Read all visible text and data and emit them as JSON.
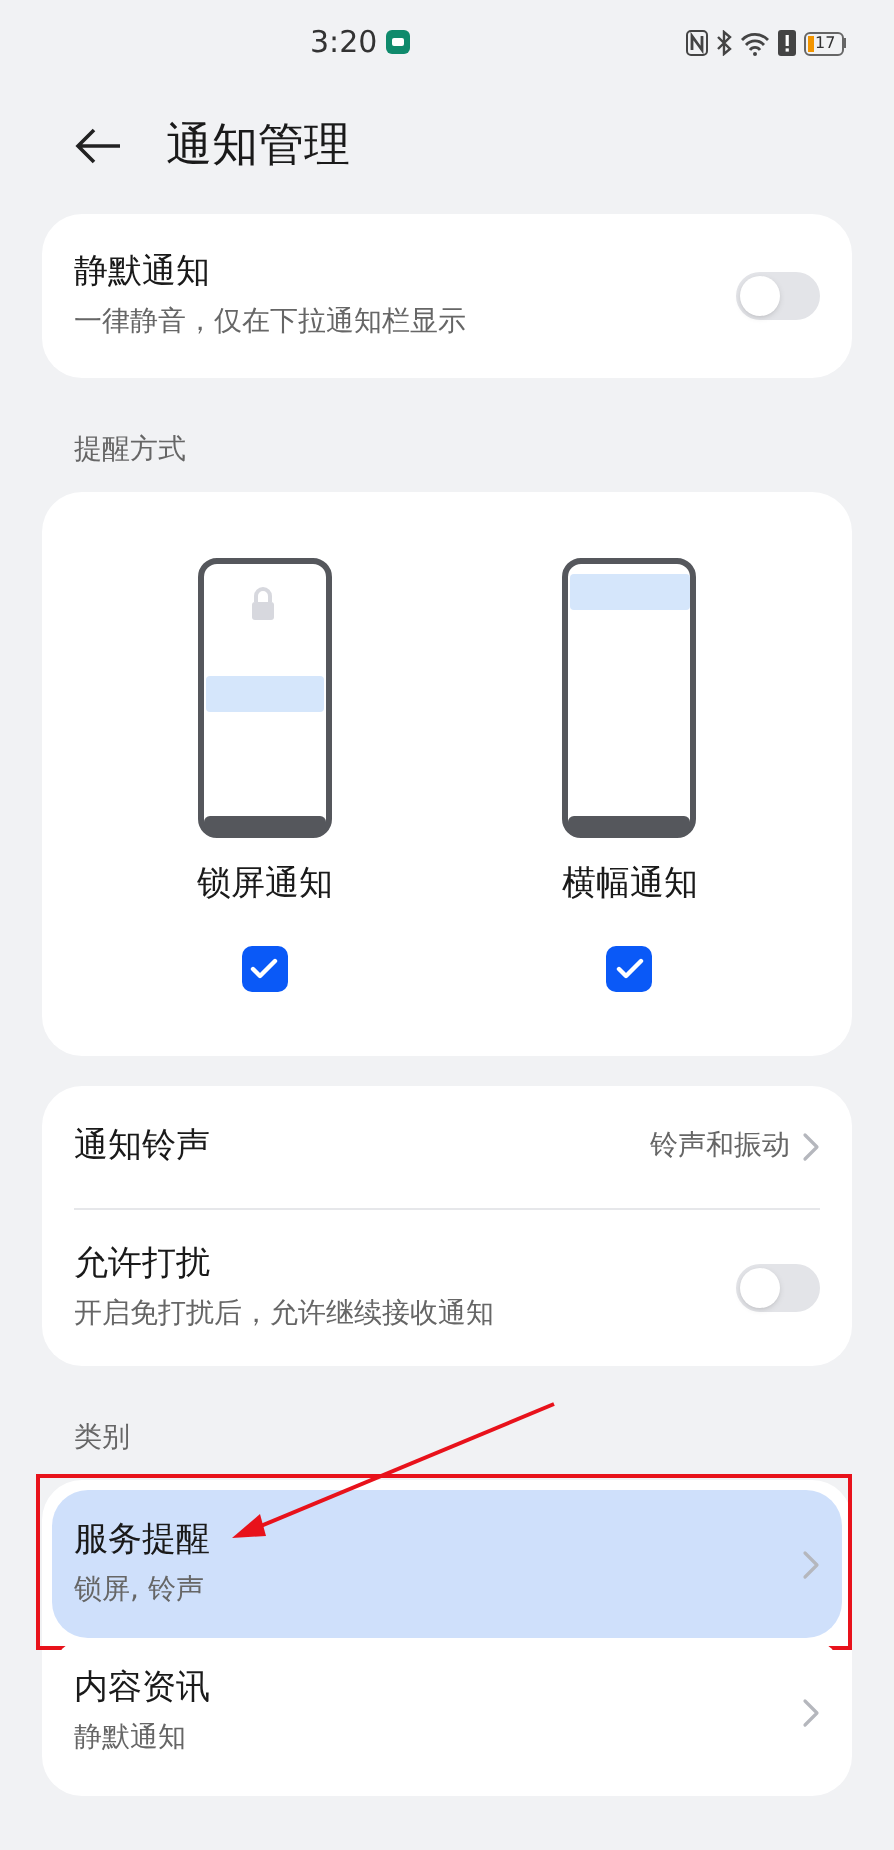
{
  "status_bar": {
    "time": "3:20",
    "battery": "17"
  },
  "header": {
    "title": "通知管理"
  },
  "silent": {
    "title": "静默通知",
    "subtitle": "一律静音，仅在下拉通知栏显示",
    "on": false
  },
  "reminder_section": {
    "label": "提醒方式",
    "options": [
      {
        "kind": "lockscreen",
        "label": "锁屏通知",
        "checked": true
      },
      {
        "kind": "banner",
        "label": "横幅通知",
        "checked": true
      }
    ]
  },
  "settings": [
    {
      "kind": "link",
      "title": "通知铃声",
      "value": "铃声和振动"
    },
    {
      "kind": "toggle",
      "title": "允许打扰",
      "subtitle": "开启免打扰后，允许继续接收通知",
      "on": false
    }
  ],
  "category_section": {
    "label": "类别",
    "items": [
      {
        "title": "服务提醒",
        "subtitle": "锁屏, 铃声",
        "selected": true,
        "annotated": true
      },
      {
        "title": "内容资讯",
        "subtitle": "静默通知",
        "selected": false,
        "annotated": false
      }
    ]
  }
}
